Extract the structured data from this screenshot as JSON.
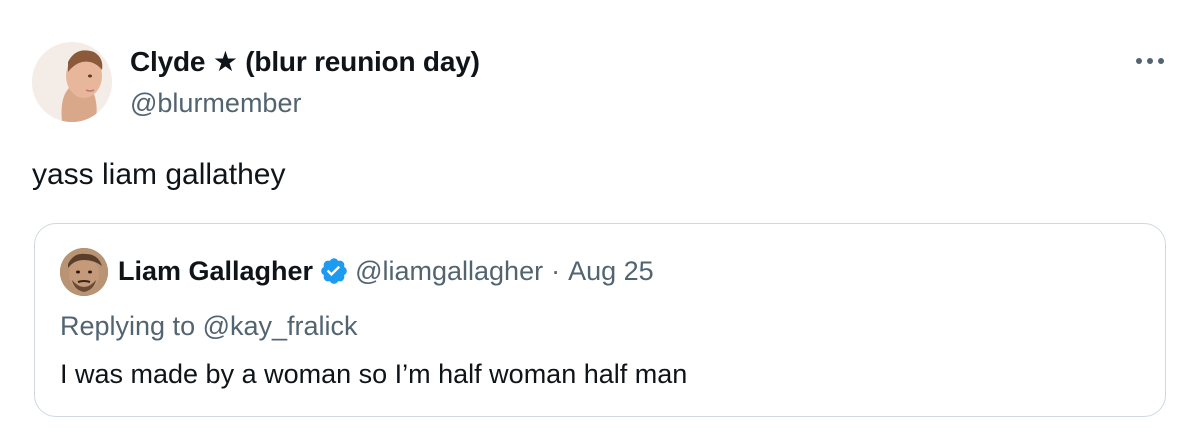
{
  "tweet": {
    "author": {
      "display_name": "Clyde ★ (blur reunion day)",
      "handle": "@blurmember"
    },
    "text": "yass liam gallathey",
    "more_icon": "more-horizontal-icon",
    "quoted": {
      "author": {
        "display_name": "Liam Gallagher",
        "handle": "@liamgallagher",
        "verified": true
      },
      "separator": "·",
      "date": "Aug 25",
      "replying_to_prefix": "Replying to ",
      "replying_to": "@kay_fralick",
      "text": "I was made by a woman so I’m half woman half man"
    }
  },
  "colors": {
    "text": "#0f1419",
    "secondary": "#536471",
    "border": "#cfd9de",
    "verified_blue": "#1d9bf0"
  }
}
